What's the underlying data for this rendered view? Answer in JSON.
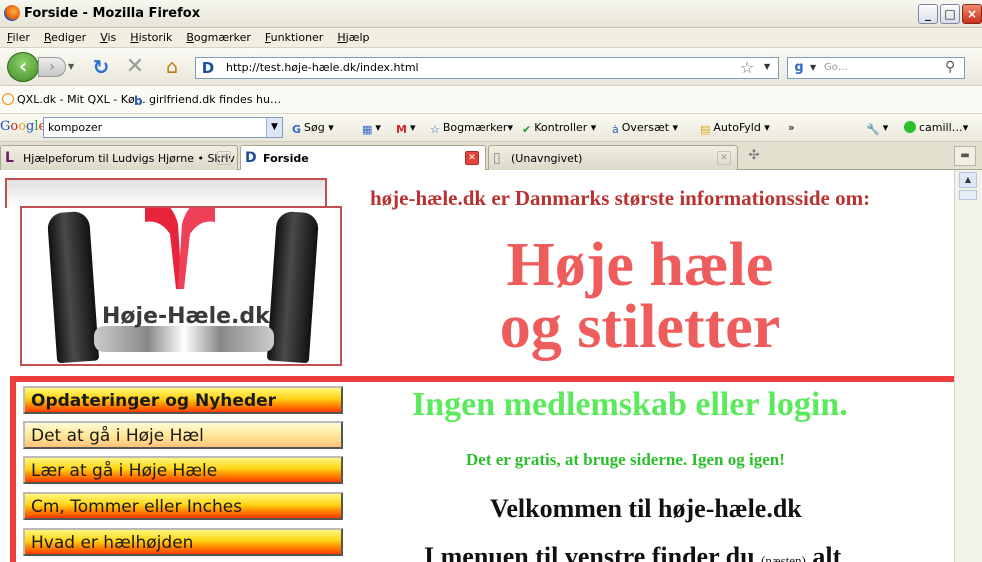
{
  "window": {
    "title": "Forside - Mozilla Firefox",
    "controls": {
      "minimize": "_",
      "maximize": "□",
      "close": "×"
    }
  },
  "menubar": [
    "Filer",
    "Rediger",
    "Vis",
    "Historik",
    "Bogmærker",
    "Funktioner",
    "Hjælp"
  ],
  "nav": {
    "url": "http://test.høje-hæle.dk/index.html",
    "search_placeholder": "Go…"
  },
  "bookmarks": [
    {
      "label": "QXL.dk - Mit QXL - Kø…"
    },
    {
      "label": "girlfriend.dk  findes hu…"
    }
  ],
  "google_toolbar": {
    "logo": [
      "G",
      "o",
      "o",
      "g",
      "l",
      "e"
    ],
    "query": "kompozer",
    "search_label": "Søg",
    "bookmarks_label": "Bogmærker",
    "check_label": "Kontroller",
    "translate_label": "Oversæt",
    "autofill_label": "AutoFyld",
    "more": "»",
    "account_label": "camill…"
  },
  "tabs": [
    {
      "label": "Hjælpeforum til Ludvigs Hjørne • Skriv …",
      "active": false
    },
    {
      "label": "Forside",
      "active": true
    },
    {
      "label": "(Unavngivet)",
      "active": false
    }
  ],
  "page": {
    "logo_text": "Høje-Hæle.dk",
    "tagline": "høje-hæle.dk er Danmarks største informationsside om:",
    "title_line1": "Høje hæle",
    "title_line2": "og stiletter",
    "menu": [
      "Opdateringer og Nyheder",
      "Det at gå i Høje Hæl",
      "Lær at gå i Høje Hæle",
      "Cm, Tommer eller Inches",
      "Hvad er hælhøjden"
    ],
    "no_membership": "Ingen medlemskab eller login.",
    "free_text": "Det er gratis, at bruge siderne.  Igen og igen!",
    "welcome": "Velkommen til høje-hæle.dk",
    "menu_text_start": "I menuen til venstre finder du",
    "menu_text_small": "(næsten)",
    "menu_text_end": "alt"
  },
  "colors": {
    "accent_red": "#ee3c3c",
    "title_red": "#ef5c5c",
    "green_heading": "#5bea5b",
    "menu_yellow": "#ffd414"
  }
}
